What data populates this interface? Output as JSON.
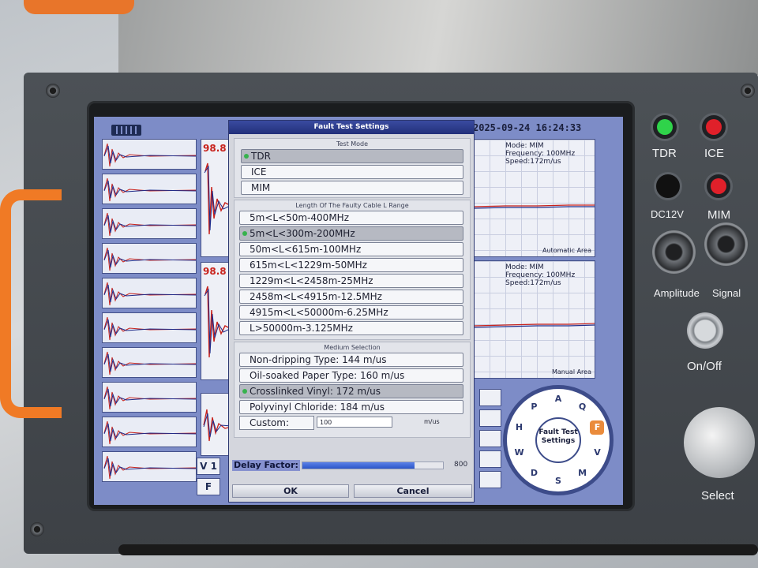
{
  "status": {
    "datetime": "2025-09-24 16:24:33"
  },
  "trace_values": {
    "top": "98.8",
    "bottom": "98.8"
  },
  "left_labels": {
    "v": "V",
    "v_num": "1",
    "f": "F"
  },
  "automatic_area": {
    "mode": "Mode: MIM",
    "frequency": "Frequency: 100MHz",
    "speed": "Speed:172m/us",
    "label": "Automatic Area"
  },
  "manual_area": {
    "mode": "Mode: MIM",
    "frequency": "Frequency: 100MHz",
    "speed": "Speed:172m/us",
    "label": "Manual Area"
  },
  "dial": {
    "center_label": "Fault Test Settings",
    "icons": [
      "A",
      "Q",
      "F",
      "V",
      "M",
      "S",
      "D",
      "W",
      "H",
      "P"
    ]
  },
  "dialog": {
    "title": "Fault Test Settings",
    "test_mode": {
      "title": "Test Mode",
      "options": [
        "TDR",
        "ICE",
        "MIM"
      ],
      "selected": 0
    },
    "cable_range": {
      "title": "Length Of The Faulty Cable L Range",
      "options": [
        "5m<L<50m-400MHz",
        "5m<L<300m-200MHz",
        "50m<L<615m-100MHz",
        "615m<L<1229m-50MHz",
        "1229m<L<2458m-25MHz",
        "2458m<L<4915m-12.5MHz",
        "4915m<L<50000m-6.25MHz",
        "L>50000m-3.125MHz"
      ],
      "selected": 1
    },
    "medium": {
      "title": "Medium Selection",
      "options": [
        "Non-dripping Type: 144 m/us",
        "Oil-soaked Paper Type: 160 m/us",
        "Crosslinked Vinyl: 172 m/us",
        "Polyvinyl Chloride: 184 m/us"
      ],
      "selected": 2,
      "custom_label": "Custom:",
      "custom_value": "100",
      "custom_unit": "m/us"
    },
    "delay": {
      "label": "Delay Factor:",
      "value": "800",
      "fill_fraction": 0.8
    },
    "ok_label": "OK",
    "cancel_label": "Cancel"
  },
  "hardware": {
    "tdr_label": "TDR",
    "ice_label": "ICE",
    "dc_label": "DC12V",
    "mim_label": "MIM",
    "amplitude_label": "Amplitude",
    "signal_label": "Signal",
    "onoff_label": "On/Off",
    "select_label": "Select",
    "colors": {
      "tdr_led": "#2fd34a",
      "ice_led": "#e0202a",
      "mim_led": "#e0202a",
      "device_orange": "#f07a25"
    }
  }
}
